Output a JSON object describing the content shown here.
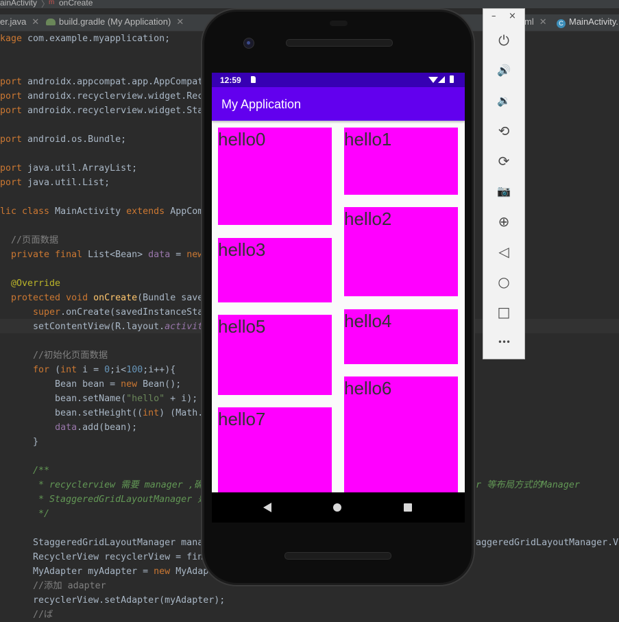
{
  "breadcrumb": {
    "class_name": "ainActivity",
    "sep": "〉",
    "method": "onCreate",
    "method_badge": "m"
  },
  "tabs": [
    {
      "label": "er.java"
    },
    {
      "label": "build.gradle (My Application)"
    },
    {
      "label": "ml"
    },
    {
      "label": "MainActivity."
    }
  ],
  "code": {
    "l1": [
      "kage",
      " com.example.myapplication;"
    ],
    "l2": [
      "port",
      " androidx.appcompat.app.AppCompat"
    ],
    "l3": [
      "port",
      " androidx.recyclerview.widget.Recy"
    ],
    "l4": [
      "port",
      " androidx.recyclerview.widget.Stag"
    ],
    "l5": [
      "port",
      " android.os.Bundle;"
    ],
    "l6": [
      "port",
      " java.util.ArrayList;"
    ],
    "l7": [
      "port",
      " java.util.List;"
    ],
    "l8": [
      "lic class",
      " MainActivity ",
      "extends",
      " AppCom"
    ],
    "l9": "  //页面数据",
    "l10": [
      "  private final",
      " List<Bean> ",
      "data",
      " = ",
      "new"
    ],
    "l11": "  @Override",
    "l12": [
      "  protected void",
      " ",
      "onCreate",
      "(Bundle saved"
    ],
    "l13": [
      "      super",
      ".onCreate(savedInstanceStat"
    ],
    "l14": [
      "      setContentView(R.layout.",
      "activit"
    ],
    "l15": "      //初始化页面数据",
    "l16": [
      "      for",
      " (",
      "int",
      " i = ",
      "0",
      ";i<",
      "100",
      ";i++){"
    ],
    "l17": [
      "          Bean bean = ",
      "new",
      " Bean();"
    ],
    "l18": [
      "          bean.setName(",
      "\"hello\"",
      " + i);"
    ],
    "l19": [
      "          bean.setHeight((",
      "int",
      ") (Math."
    ],
    "l20": [
      "          ",
      "data",
      ".add(bean);"
    ],
    "l21": "      }",
    "l22": "      /**",
    "l23a": "       * recyclerview 需要 manager ,确",
    "l23b": "r 等布局方式的Manager",
    "l24": "       * StaggeredGridLayoutManager 是",
    "l25": "       */",
    "l26a": "      StaggeredGridLayoutManager manag",
    "l26b": "aggeredGridLayoutManager.V",
    "l27": "      RecyclerView recyclerView = find",
    "l28": [
      "      MyAdapter myAdapter = ",
      "new",
      " MyAdap"
    ],
    "l29": "      //添加 adapter",
    "l30": "      recyclerView.setAdapter(myAdapter);",
    "l31": "      //ば"
  },
  "phone": {
    "status_time": "12:59",
    "app_title": "My Application",
    "items": [
      "hello0",
      "hello1",
      "hello2",
      "hello3",
      "hello4",
      "hello5",
      "hello6",
      "hello7"
    ]
  },
  "toolbar": {
    "minimize": "–",
    "close": "×",
    "buttons": [
      {
        "name": "power-icon",
        "glyph": "⏻"
      },
      {
        "name": "volume-up-icon",
        "glyph": "🔊"
      },
      {
        "name": "volume-down-icon",
        "glyph": "🔉"
      },
      {
        "name": "rotate-left-icon",
        "glyph": "⟲"
      },
      {
        "name": "rotate-right-icon",
        "glyph": "⟳"
      },
      {
        "name": "camera-icon",
        "glyph": "📷"
      },
      {
        "name": "zoom-icon",
        "glyph": "⊕"
      },
      {
        "name": "back-icon",
        "glyph": "◁"
      },
      {
        "name": "home-icon",
        "glyph": "○"
      },
      {
        "name": "overview-icon",
        "glyph": "□"
      },
      {
        "name": "more-icon",
        "glyph": "•••"
      }
    ]
  },
  "colors": {
    "card": "#ff00ff",
    "appbar": "#6200ee",
    "statusbar": "#3700b3",
    "editor_bg": "#2b2b2b"
  }
}
